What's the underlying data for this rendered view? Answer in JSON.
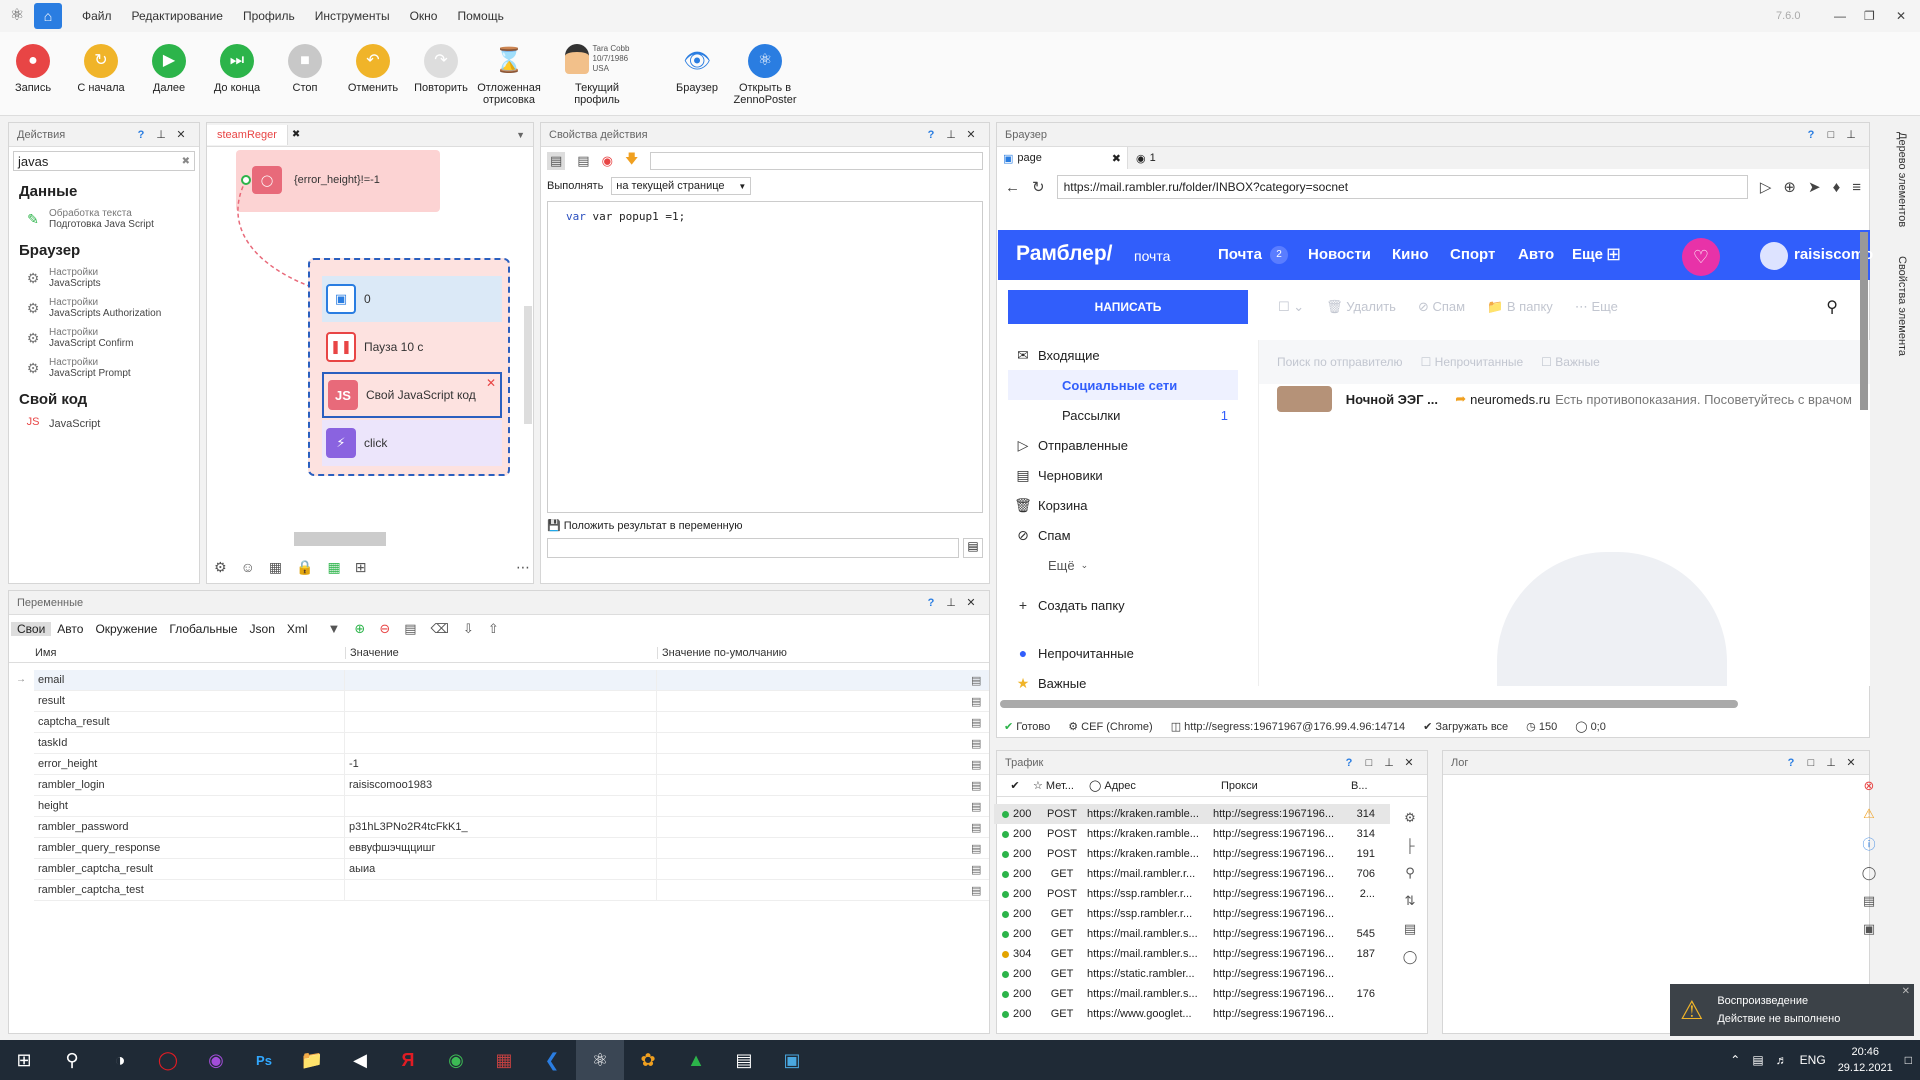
{
  "app": {
    "version": "7.6.0"
  },
  "menu": [
    "Файл",
    "Редактирование",
    "Профиль",
    "Инструменты",
    "Окно",
    "Помощь"
  ],
  "toolbar": {
    "record": "Запись",
    "restart": "С начала",
    "next": "Далее",
    "to_end": "До конца",
    "stop": "Стоп",
    "undo": "Отменить",
    "redo": "Повторить",
    "delayed_render_1": "Отложенная",
    "delayed_render_2": "отрисовка",
    "profile_name": "Tara Cobb",
    "profile_date": "10/7/1986",
    "profile_country": "USA",
    "current_profile": "Текущий профиль",
    "browser": "Браузер",
    "open_in_1": "Открыть в",
    "open_in_2": "ZennoPoster"
  },
  "actions_panel": {
    "title": "Действия",
    "search": "javas",
    "sec_data": "Данные",
    "text_proc_1": "Обработка текста",
    "text_proc_2": "Подготовка Java Script",
    "sec_browser": "Браузер",
    "items": [
      {
        "a": "Настройки",
        "b": "JavaScripts"
      },
      {
        "a": "Настройки",
        "b": "JavaScripts Authorization"
      },
      {
        "a": "Настройки",
        "b": "JavaScript Confirm"
      },
      {
        "a": "Настройки",
        "b": "JavaScript Prompt"
      }
    ],
    "sec_code": "Свой код",
    "js": "JavaScript"
  },
  "canvas": {
    "tab": "steamReger",
    "cond": "{error_height}!=-1",
    "n1": "0",
    "n2": "Пауза 10 с",
    "n3": "Свой JavaScript код",
    "n4": "click"
  },
  "props": {
    "title": "Свойства действия",
    "exec_label": "Выполнять",
    "exec_value": "на текущей странице",
    "code": "var popup1 =1;",
    "put_result": "Положить результат в переменную"
  },
  "vars": {
    "title": "Переменные",
    "tabs": [
      "Свои",
      "Авто",
      "Окружение",
      "Глобальные",
      "Json",
      "Xml"
    ],
    "col_name": "Имя",
    "col_value": "Значение",
    "col_default": "Значение по-умолчанию",
    "rows": [
      {
        "n": "email",
        "v": ""
      },
      {
        "n": "result",
        "v": ""
      },
      {
        "n": "captcha_result",
        "v": ""
      },
      {
        "n": "taskId",
        "v": ""
      },
      {
        "n": "error_height",
        "v": "-1"
      },
      {
        "n": "rambler_login",
        "v": "raisiscomoo1983"
      },
      {
        "n": "height",
        "v": ""
      },
      {
        "n": "rambler_password",
        "v": "p31hL3PNo2R4tcFkK1_"
      },
      {
        "n": "rambler_query_response",
        "v": "еввуфшэчщцишг"
      },
      {
        "n": "rambler_captcha_result",
        "v": "аыиа"
      },
      {
        "n": "rambler_captcha_test",
        "v": ""
      }
    ]
  },
  "browser": {
    "title": "Браузер",
    "tab1": "page",
    "tab2": "1",
    "url": "https://mail.rambler.ru/folder/INBOX?category=socnet",
    "logo": "Рамблер/",
    "logo2": "почта",
    "nav": [
      "Почта",
      "Новости",
      "Кино",
      "Спорт",
      "Авто",
      "Еще"
    ],
    "mail_badge": "2",
    "user": "raisiscomo",
    "compose": "НАПИСАТЬ",
    "tb_delete": "Удалить",
    "tb_spam": "Спам",
    "tb_folder": "В папку",
    "tb_more": "Еще",
    "f_search": "Поиск по отправителю",
    "f_unread": "Непрочитанные",
    "f_important": "Важные",
    "folders": {
      "inbox": "Входящие",
      "social": "Социальные сети",
      "news": "Рассылки",
      "news_count": "1",
      "sent": "Отправленные",
      "drafts": "Черновики",
      "trash": "Корзина",
      "spam": "Спам",
      "more": "Ещё",
      "create": "Создать папку",
      "unread": "Непрочитанные",
      "important": "Важные"
    },
    "msg": {
      "subject": "Ночной ЭЭГ ...",
      "sender": "neuromeds.ru",
      "text": "Есть противопоказания. Посоветуйтесь с врачом"
    },
    "status": {
      "ready": "Готово",
      "engine": "CEF (Chrome)",
      "proxy": "http://segress:19671967@176.99.4.96:14714",
      "load": "Загружать все",
      "time": "150",
      "coords": "0;0"
    }
  },
  "side": {
    "tree": "Дерево элементов",
    "props": "Свойства элемента"
  },
  "traffic": {
    "title": "Трафик",
    "col_method": "Мет...",
    "col_addr": "Адрес",
    "col_proxy": "Прокси",
    "col_size": "В...",
    "rows": [
      {
        "s": "200",
        "m": "POST",
        "a": "https://kraken.ramble...",
        "p": "http://segress:1967196...",
        "z": "314",
        "c": "#2cb44a"
      },
      {
        "s": "200",
        "m": "POST",
        "a": "https://kraken.ramble...",
        "p": "http://segress:1967196...",
        "z": "314",
        "c": "#2cb44a"
      },
      {
        "s": "200",
        "m": "POST",
        "a": "https://kraken.ramble...",
        "p": "http://segress:1967196...",
        "z": "191",
        "c": "#2cb44a"
      },
      {
        "s": "200",
        "m": "GET",
        "a": "https://mail.rambler.r...",
        "p": "http://segress:1967196...",
        "z": "706",
        "c": "#2cb44a"
      },
      {
        "s": "200",
        "m": "POST",
        "a": "https://ssp.rambler.r...",
        "p": "http://segress:1967196...",
        "z": "2...",
        "c": "#2cb44a"
      },
      {
        "s": "200",
        "m": "GET",
        "a": "https://ssp.rambler.r...",
        "p": "http://segress:1967196...",
        "z": "",
        "c": "#2cb44a"
      },
      {
        "s": "200",
        "m": "GET",
        "a": "https://mail.rambler.s...",
        "p": "http://segress:1967196...",
        "z": "545",
        "c": "#2cb44a"
      },
      {
        "s": "304",
        "m": "GET",
        "a": "https://mail.rambler.s...",
        "p": "http://segress:1967196...",
        "z": "187",
        "c": "#e3a400"
      },
      {
        "s": "200",
        "m": "GET",
        "a": "https://static.rambler...",
        "p": "http://segress:1967196...",
        "z": "",
        "c": "#2cb44a"
      },
      {
        "s": "200",
        "m": "GET",
        "a": "https://mail.rambler.s...",
        "p": "http://segress:1967196...",
        "z": "176",
        "c": "#2cb44a"
      },
      {
        "s": "200",
        "m": "GET",
        "a": "https://www.googlet...",
        "p": "http://segress:1967196...",
        "z": "",
        "c": "#2cb44a"
      }
    ]
  },
  "log": {
    "title": "Лог"
  },
  "toast": {
    "title": "Воспроизведение",
    "text": "Действие не выполнено"
  },
  "taskbar": {
    "lang": "ENG",
    "time": "20:46",
    "date": "29.12.2021"
  }
}
